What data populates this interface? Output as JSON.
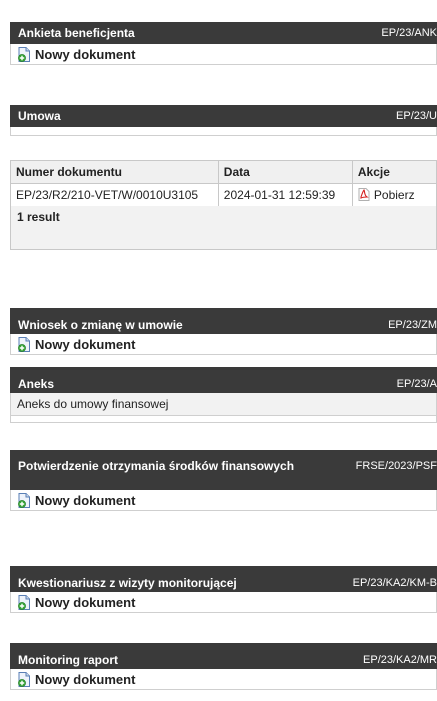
{
  "sections": {
    "ankieta": {
      "title": "Ankieta beneficjenta",
      "code": "EP/23/ANK",
      "action": "Nowy dokument"
    },
    "umowa": {
      "title": "Umowa",
      "code": "EP/23/U"
    },
    "wniosek": {
      "title": "Wniosek o zmianę w umowie",
      "code": "EP/23/ZM",
      "action": "Nowy dokument"
    },
    "aneks": {
      "title": "Aneks",
      "code": "EP/23/A",
      "info": "Aneks do umowy finansowej"
    },
    "potwierdzenie": {
      "title": "Potwierdzenie otrzymania środków finansowych",
      "code": "FRSE/2023/PSF",
      "action": "Nowy dokument"
    },
    "kwestionariusz": {
      "title": "Kwestionariusz z wizyty monitorującej",
      "code": "EP/23/KA2/KM-B",
      "action": "Nowy dokument"
    },
    "monitoring": {
      "title": "Monitoring raport",
      "code": "EP/23/KA2/MR",
      "action": "Nowy dokument"
    }
  },
  "documents_table": {
    "headers": {
      "number": "Numer dokumentu",
      "date": "Data",
      "actions": "Akcje"
    },
    "rows": [
      {
        "number": "EP/23/R2/210-VET/W/0010U3105",
        "date": "2024-01-31 12:59:39",
        "action": "Pobierz"
      }
    ],
    "footer": "1 result"
  },
  "colors": {
    "header_bg": "#3a3a3a",
    "header_text": "#ffffff",
    "border": "#cfcfcf",
    "row_bg": "#f2f2f2"
  },
  "icons": {
    "new_document": "document-add-icon",
    "pdf": "pdf-icon"
  }
}
